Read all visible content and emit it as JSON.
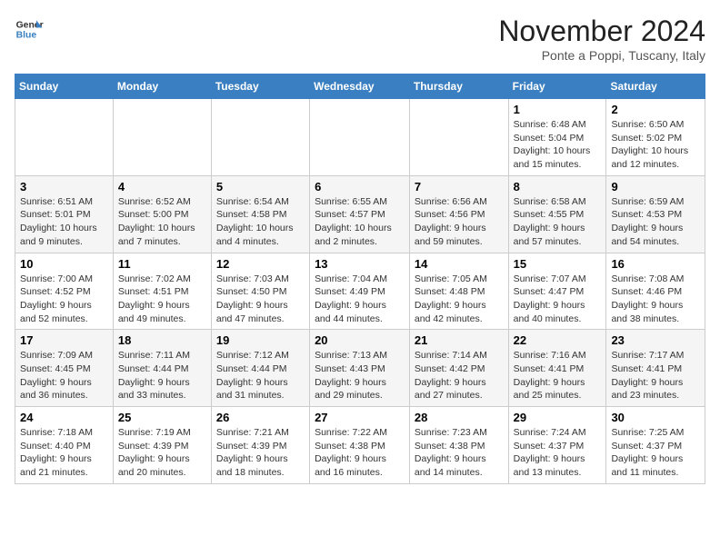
{
  "logo": {
    "line1": "General",
    "line2": "Blue"
  },
  "title": "November 2024",
  "subtitle": "Ponte a Poppi, Tuscany, Italy",
  "days_of_week": [
    "Sunday",
    "Monday",
    "Tuesday",
    "Wednesday",
    "Thursday",
    "Friday",
    "Saturday"
  ],
  "weeks": [
    [
      {
        "day": "",
        "info": ""
      },
      {
        "day": "",
        "info": ""
      },
      {
        "day": "",
        "info": ""
      },
      {
        "day": "",
        "info": ""
      },
      {
        "day": "",
        "info": ""
      },
      {
        "day": "1",
        "info": "Sunrise: 6:48 AM\nSunset: 5:04 PM\nDaylight: 10 hours and 15 minutes."
      },
      {
        "day": "2",
        "info": "Sunrise: 6:50 AM\nSunset: 5:02 PM\nDaylight: 10 hours and 12 minutes."
      }
    ],
    [
      {
        "day": "3",
        "info": "Sunrise: 6:51 AM\nSunset: 5:01 PM\nDaylight: 10 hours and 9 minutes."
      },
      {
        "day": "4",
        "info": "Sunrise: 6:52 AM\nSunset: 5:00 PM\nDaylight: 10 hours and 7 minutes."
      },
      {
        "day": "5",
        "info": "Sunrise: 6:54 AM\nSunset: 4:58 PM\nDaylight: 10 hours and 4 minutes."
      },
      {
        "day": "6",
        "info": "Sunrise: 6:55 AM\nSunset: 4:57 PM\nDaylight: 10 hours and 2 minutes."
      },
      {
        "day": "7",
        "info": "Sunrise: 6:56 AM\nSunset: 4:56 PM\nDaylight: 9 hours and 59 minutes."
      },
      {
        "day": "8",
        "info": "Sunrise: 6:58 AM\nSunset: 4:55 PM\nDaylight: 9 hours and 57 minutes."
      },
      {
        "day": "9",
        "info": "Sunrise: 6:59 AM\nSunset: 4:53 PM\nDaylight: 9 hours and 54 minutes."
      }
    ],
    [
      {
        "day": "10",
        "info": "Sunrise: 7:00 AM\nSunset: 4:52 PM\nDaylight: 9 hours and 52 minutes."
      },
      {
        "day": "11",
        "info": "Sunrise: 7:02 AM\nSunset: 4:51 PM\nDaylight: 9 hours and 49 minutes."
      },
      {
        "day": "12",
        "info": "Sunrise: 7:03 AM\nSunset: 4:50 PM\nDaylight: 9 hours and 47 minutes."
      },
      {
        "day": "13",
        "info": "Sunrise: 7:04 AM\nSunset: 4:49 PM\nDaylight: 9 hours and 44 minutes."
      },
      {
        "day": "14",
        "info": "Sunrise: 7:05 AM\nSunset: 4:48 PM\nDaylight: 9 hours and 42 minutes."
      },
      {
        "day": "15",
        "info": "Sunrise: 7:07 AM\nSunset: 4:47 PM\nDaylight: 9 hours and 40 minutes."
      },
      {
        "day": "16",
        "info": "Sunrise: 7:08 AM\nSunset: 4:46 PM\nDaylight: 9 hours and 38 minutes."
      }
    ],
    [
      {
        "day": "17",
        "info": "Sunrise: 7:09 AM\nSunset: 4:45 PM\nDaylight: 9 hours and 36 minutes."
      },
      {
        "day": "18",
        "info": "Sunrise: 7:11 AM\nSunset: 4:44 PM\nDaylight: 9 hours and 33 minutes."
      },
      {
        "day": "19",
        "info": "Sunrise: 7:12 AM\nSunset: 4:44 PM\nDaylight: 9 hours and 31 minutes."
      },
      {
        "day": "20",
        "info": "Sunrise: 7:13 AM\nSunset: 4:43 PM\nDaylight: 9 hours and 29 minutes."
      },
      {
        "day": "21",
        "info": "Sunrise: 7:14 AM\nSunset: 4:42 PM\nDaylight: 9 hours and 27 minutes."
      },
      {
        "day": "22",
        "info": "Sunrise: 7:16 AM\nSunset: 4:41 PM\nDaylight: 9 hours and 25 minutes."
      },
      {
        "day": "23",
        "info": "Sunrise: 7:17 AM\nSunset: 4:41 PM\nDaylight: 9 hours and 23 minutes."
      }
    ],
    [
      {
        "day": "24",
        "info": "Sunrise: 7:18 AM\nSunset: 4:40 PM\nDaylight: 9 hours and 21 minutes."
      },
      {
        "day": "25",
        "info": "Sunrise: 7:19 AM\nSunset: 4:39 PM\nDaylight: 9 hours and 20 minutes."
      },
      {
        "day": "26",
        "info": "Sunrise: 7:21 AM\nSunset: 4:39 PM\nDaylight: 9 hours and 18 minutes."
      },
      {
        "day": "27",
        "info": "Sunrise: 7:22 AM\nSunset: 4:38 PM\nDaylight: 9 hours and 16 minutes."
      },
      {
        "day": "28",
        "info": "Sunrise: 7:23 AM\nSunset: 4:38 PM\nDaylight: 9 hours and 14 minutes."
      },
      {
        "day": "29",
        "info": "Sunrise: 7:24 AM\nSunset: 4:37 PM\nDaylight: 9 hours and 13 minutes."
      },
      {
        "day": "30",
        "info": "Sunrise: 7:25 AM\nSunset: 4:37 PM\nDaylight: 9 hours and 11 minutes."
      }
    ]
  ]
}
